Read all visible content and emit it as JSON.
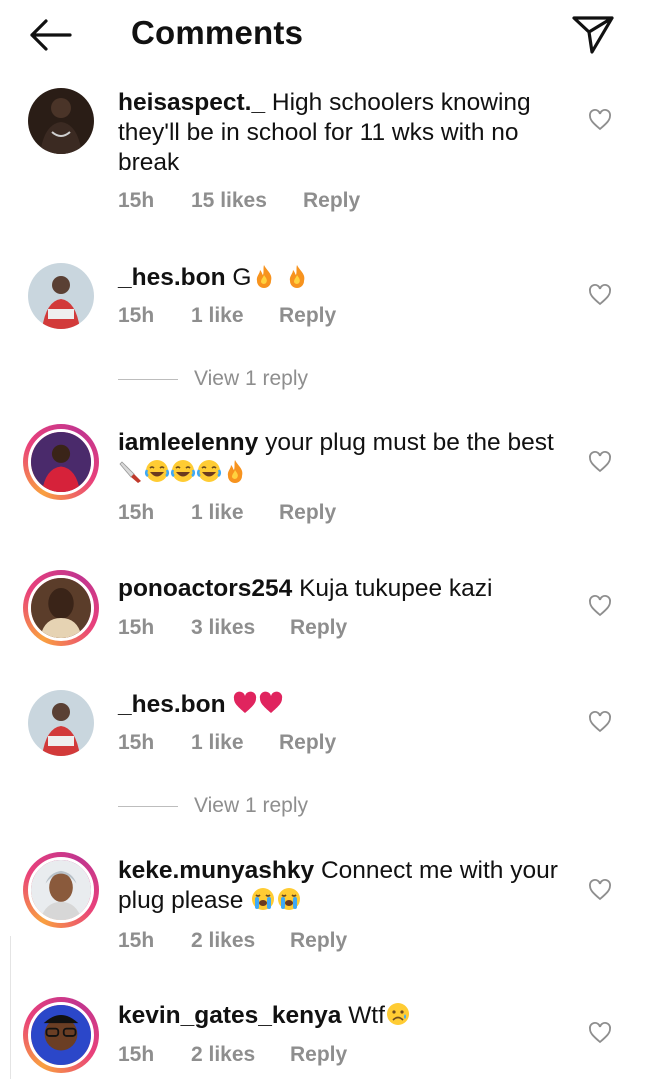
{
  "header": {
    "title": "Comments",
    "back_icon": "arrow-left-icon",
    "send_icon": "paper-plane-icon"
  },
  "comments": [
    {
      "user": "heisaspect._",
      "text": "High schoolers knowing they'll be in school for 11 wks with no break",
      "time": "15h",
      "likes": "15 likes",
      "reply": "Reply"
    },
    {
      "user": "_hes.bon",
      "text": "G",
      "emojis": "fire fire",
      "time": "15h",
      "likes": "1 like",
      "reply": "Reply",
      "view_replies": "View 1 reply"
    },
    {
      "user": "iamleelenny",
      "text": "your plug must be the best",
      "emojis": "knife tears-of-joy tears-of-joy tears-of-joy fire",
      "time": "15h",
      "likes": "1 like",
      "reply": "Reply"
    },
    {
      "user": "ponoactors254",
      "text": "Kuja tukupee kazi",
      "time": "15h",
      "likes": "3 likes",
      "reply": "Reply"
    },
    {
      "user": "_hes.bon",
      "text": "",
      "emojis": "red-heart red-heart",
      "time": "15h",
      "likes": "1 like",
      "reply": "Reply",
      "view_replies": "View 1 reply"
    },
    {
      "user": "keke.munyashky",
      "text": "Connect me with your plug please",
      "emojis": "crying crying",
      "time": "15h",
      "likes": "2 likes",
      "reply": "Reply"
    },
    {
      "user": "kevin_gates_kenya",
      "text": "Wtf",
      "emojis": "sad-relieved",
      "time": "15h",
      "likes": "2 likes",
      "reply": "Reply"
    }
  ],
  "colors": {
    "meta_gray": "#8e8e8e",
    "story_ring": "#e8407b",
    "heart_red": "#e0245e",
    "fire": "#f7931e"
  }
}
